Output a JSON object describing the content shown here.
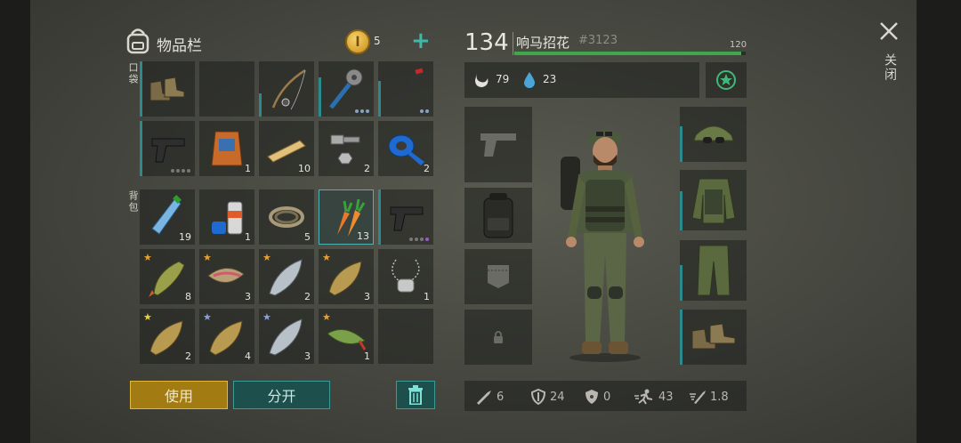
{
  "inventory": {
    "title": "物品栏",
    "coins": "5",
    "pocket_label": "口袋",
    "backpack_label": "背包",
    "counts": {
      "pistol_ammo_dots": "",
      "fish_feed": "1",
      "wood_planks": "10",
      "nuts_bolts": "2",
      "tape": "2",
      "water": "19",
      "spray": "1",
      "rope": "5",
      "carrot": "13",
      "perch": "8",
      "trout": "3",
      "salmon": "2",
      "carp1": "3",
      "tags": "1",
      "carp2": "2",
      "carp3": "4",
      "salmon2": "3",
      "pike": "1"
    },
    "use_button": "使用",
    "split_button": "分开"
  },
  "player": {
    "level": "134",
    "name": "响马招花",
    "id": "#3123",
    "xp_max": "120",
    "xp_fraction": 0.98,
    "hunger": "79",
    "thirst": "23"
  },
  "stats": {
    "attack": "6",
    "defense": "24",
    "radiation": "0",
    "speed": "43",
    "rate": "1.8"
  },
  "close": {
    "label": "关闭"
  },
  "colors": {
    "accent_teal": "#2c8a8c",
    "xp_green": "#3ea84a",
    "use_button": "#c79a1e",
    "split_button": "#1f5a59"
  }
}
